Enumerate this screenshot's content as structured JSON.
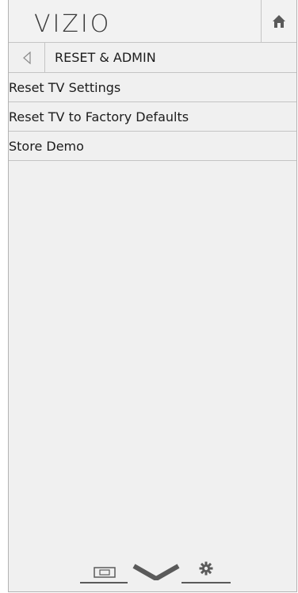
{
  "header": {
    "logo_text": "VIZIO",
    "home_icon": "home-icon"
  },
  "breadcrumb": {
    "back_icon": "chevron-left-icon",
    "title": "RESET & ADMIN"
  },
  "menu": {
    "items": [
      {
        "label": "Reset TV Settings"
      },
      {
        "label": "Reset TV to Factory Defaults"
      },
      {
        "label": "Store Demo"
      }
    ]
  },
  "bottom_bar": {
    "icons": [
      "picture-icon",
      "vizio-v-icon",
      "gear-icon"
    ]
  },
  "colors": {
    "panel_bg": "#f0f0f0",
    "divider": "#c4c4c4",
    "text": "#1c1c1c",
    "icon": "#5a5a5a"
  }
}
